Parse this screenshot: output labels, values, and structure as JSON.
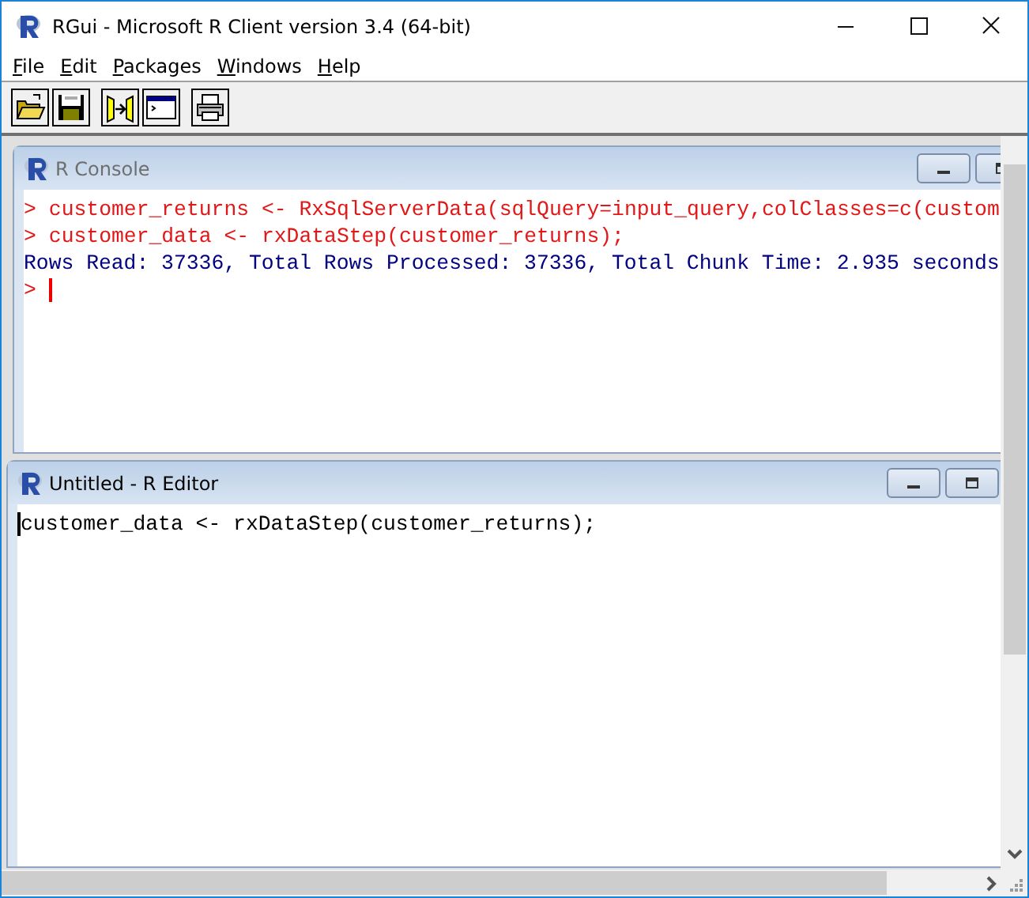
{
  "window": {
    "title": "RGui  -  Microsoft R Client version 3.4 (64-bit)"
  },
  "menu": [
    "File",
    "Edit",
    "Packages",
    "Windows",
    "Help"
  ],
  "toolbar": [
    {
      "kind": "open"
    },
    {
      "kind": "save"
    },
    {
      "kind": "load"
    },
    {
      "kind": "console"
    },
    {
      "kind": "print"
    }
  ],
  "console": {
    "title": "R Console",
    "active": false,
    "lines": [
      {
        "kind": "input",
        "prompt": ">",
        "text": "customer_returns <- RxSqlServerData(sqlQuery=input_query,colClasses=c(custom"
      },
      {
        "kind": "input",
        "prompt": ">",
        "text": "customer_data <- rxDataStep(customer_returns);"
      },
      {
        "kind": "output",
        "text": "Rows Read: 37336, Total Rows Processed: 37336, Total Chunk Time: 2.935 seconds"
      },
      {
        "kind": "prompt",
        "prompt": ">"
      }
    ]
  },
  "editor": {
    "title": "Untitled - R Editor",
    "active": true,
    "lines": [
      "customer_data <- rxDataStep(customer_returns);"
    ]
  }
}
